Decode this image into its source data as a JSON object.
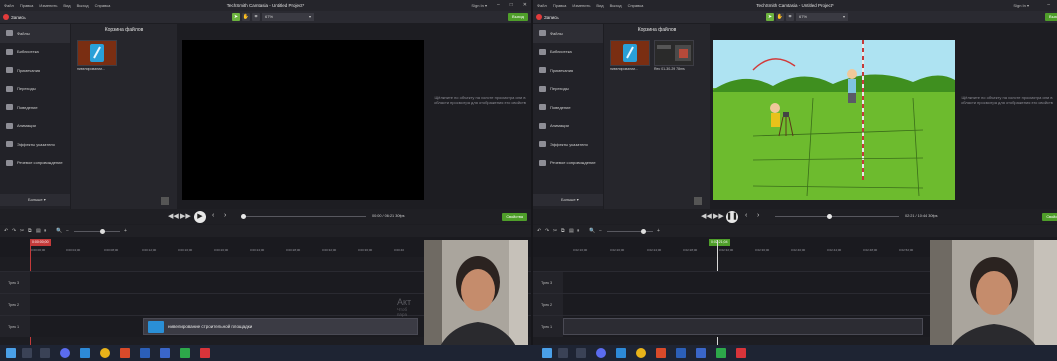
{
  "app": {
    "title": "TechSmith Camtasia - Untitled Project*",
    "menu": [
      "Файл",
      "Правка",
      "Изменить",
      "Вид",
      "Выход",
      "Справка"
    ],
    "sign_in": "Sign In ▾",
    "win_controls": [
      "–",
      "□",
      "✕"
    ],
    "record_label": "Запись",
    "zoom": "67%",
    "share_label": "Выход",
    "props_label": "Свойства",
    "more_label": "Больше ▾"
  },
  "nav": [
    {
      "label": "Файлы"
    },
    {
      "label": "Библиотека"
    },
    {
      "label": "Примечания"
    },
    {
      "label": "Переходы"
    },
    {
      "label": "Поведение"
    },
    {
      "label": "Анимации"
    },
    {
      "label": "Эффекты указателя"
    },
    {
      "label": "Речевое сопровождение"
    }
  ],
  "bin": {
    "title": "Корзина файлов",
    "clip1": "нивелировании...",
    "clip2": "Rec 01-30-29 78ms"
  },
  "canvas_hint": "Щёлкните по объекту на холсте просмотра или в области просмотра для отображения его свойств",
  "left": {
    "timecode": "00:00 / 06:21   30fps",
    "playhead": "0:00:00;00",
    "ticks": [
      "0:00:00;00",
      "0:00:04;00",
      "0:00:08;00",
      "0:00:12;00",
      "0:00:16;00",
      "0:00:20;00",
      "0:00:24;00",
      "0:00:28;00",
      "0:00:32;00",
      "0:00:36;00",
      "0:00:40"
    ],
    "tracks": [
      "Трек 3",
      "Трек 2",
      "Трек 1"
    ],
    "clip_label": "нивелирование строительной площадки",
    "watermark": [
      "Акт",
      "Чтоб",
      "пара"
    ]
  },
  "right": {
    "timecode": "02:21 / 10:44   30fps",
    "playhead": "0:02:21;04",
    "ticks": [
      "0:02:16;00",
      "0:02:20;00",
      "0:02:24;00",
      "0:02:28;00",
      "0:02:32;00",
      "0:02:36;00",
      "0:02:40;00",
      "0:02:44;00",
      "0:02:48;00",
      "0:02:52;00"
    ],
    "tracks": [
      "Трек 3",
      "Трек 2",
      "Трек 1"
    ]
  },
  "colors": {
    "accent": "#4f9e2a",
    "record": "#e23b3b"
  }
}
